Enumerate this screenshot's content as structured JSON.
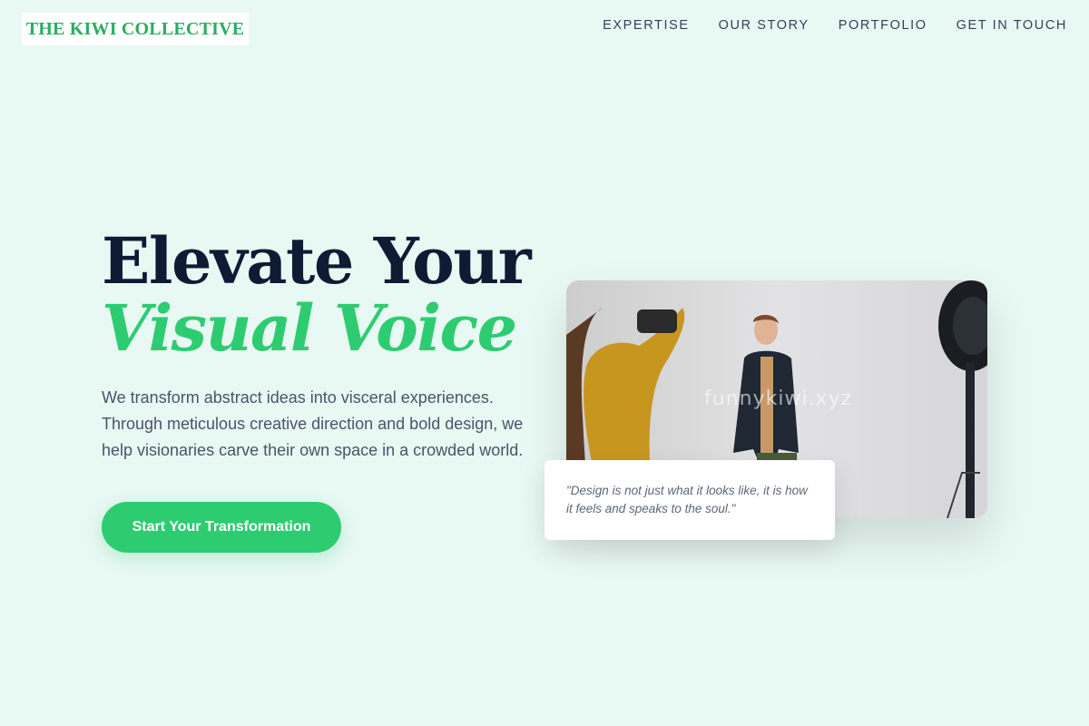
{
  "brand": {
    "name": "THE KIWI COLLECTIVE"
  },
  "nav": {
    "items": [
      {
        "label": "EXPERTISE"
      },
      {
        "label": "OUR STORY"
      },
      {
        "label": "PORTFOLIO"
      },
      {
        "label": "GET IN TOUCH"
      }
    ]
  },
  "hero": {
    "title_line1": "Elevate Your",
    "title_line2": "Visual Voice",
    "description": "We transform abstract ideas into visceral experiences. Through meticulous creative direction and bold design, we help visionaries carve their own space in a crowded world.",
    "cta_label": "Start Your Transformation"
  },
  "photo": {
    "watermark": "funnykiwi.xyz",
    "quote": "\"Design is not just what it looks like, it is how it feels and speaks to the soul.\""
  },
  "colors": {
    "background": "#e8f8f3",
    "accent": "#2ecc71",
    "heading": "#0f1b33",
    "body_text": "#475569"
  }
}
